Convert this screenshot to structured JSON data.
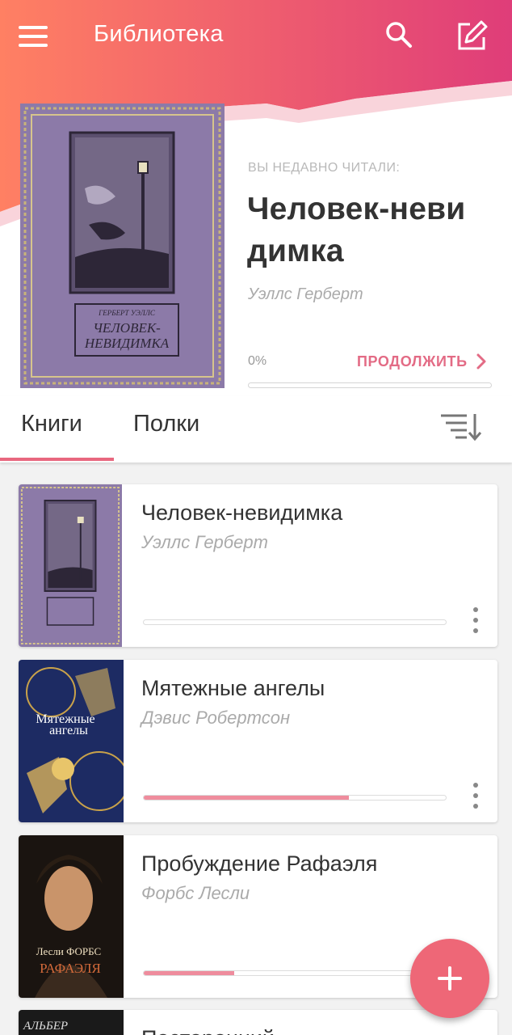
{
  "app": {
    "title": "Библиотека",
    "accent": "#e8677f",
    "gradient_start": "#ff8063",
    "gradient_end": "#df3d79"
  },
  "header_icons": {
    "menu": "menu-icon",
    "search": "search-icon",
    "edit": "edit-icon"
  },
  "recent": {
    "label": "ВЫ НЕДАВНО ЧИТАЛИ:",
    "title": "Человек-невидимка",
    "title_line1": "Человек-неви",
    "title_line2": "димка",
    "author": "Уэллс Герберт",
    "progress_text": "0%",
    "progress": 0,
    "continue_label": "ПРОДОЛЖИТЬ",
    "cover_text_author": "ГЕРБЕРТ УЭЛЛС",
    "cover_text_title1": "ЧЕЛОВЕК-",
    "cover_text_title2": "НЕВИДИМКА"
  },
  "tabs": [
    {
      "label": "Книги",
      "active": true
    },
    {
      "label": "Полки",
      "active": false
    }
  ],
  "books": [
    {
      "title": "Человек-невидимка",
      "author": "Уэллс Герберт",
      "progress": 0,
      "cover": "purple-ornate"
    },
    {
      "title": "Мятежные ангелы",
      "author": "Дэвис Робертсон",
      "progress": 0.68,
      "cover": "blue-zodiac",
      "cover_text": "Мятежные ангелы"
    },
    {
      "title": "Пробуждение Рафаэля",
      "author": "Форбс Лесли",
      "progress": 0.3,
      "cover": "portrait-dark",
      "cover_text_author": "Лесли ФОРБС",
      "cover_text_title": "РАФАЭЛЯ"
    },
    {
      "title": "Посторонний",
      "author": "",
      "progress": 0,
      "cover": "dark",
      "cover_text": "АЛЬБЕР КАМЮ"
    }
  ],
  "fab": {
    "icon": "plus-icon"
  }
}
